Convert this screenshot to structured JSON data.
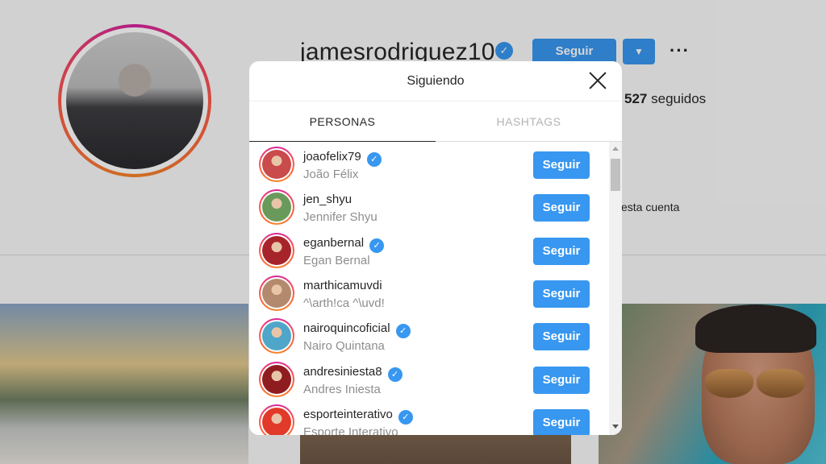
{
  "profile": {
    "username": "jamesrodriguez10",
    "follow_label": "Seguir",
    "more_label": "···",
    "following_count": "527",
    "following_label": "seguidos",
    "account_text": "esta cuenta"
  },
  "modal": {
    "title": "Siguiendo",
    "tabs": [
      {
        "label": "PERSONAS",
        "active": true
      },
      {
        "label": "HASHTAGS",
        "active": false
      }
    ],
    "follow_label": "Seguir",
    "accounts": [
      {
        "username": "joaofelix79",
        "full_name": "João Félix",
        "verified": true,
        "avatar_color": "#c94b4b"
      },
      {
        "username": "jen_shyu",
        "full_name": "Jennifer Shyu",
        "verified": false,
        "avatar_color": "#6a9a5b"
      },
      {
        "username": "eganbernal",
        "full_name": "Egan Bernal",
        "verified": true,
        "avatar_color": "#a8242b"
      },
      {
        "username": "marthicamuvdi",
        "full_name": "^\\arth!ca ^\\uvd!",
        "verified": false,
        "avatar_color": "#b38a6d"
      },
      {
        "username": "nairoquincoficial",
        "full_name": "Nairo Quintana",
        "verified": true,
        "avatar_color": "#4fa6c8"
      },
      {
        "username": "andresiniesta8",
        "full_name": "Andres Iniesta",
        "verified": true,
        "avatar_color": "#8f1d20"
      },
      {
        "username": "esporteinterativo",
        "full_name": "Esporte Interativo",
        "verified": true,
        "avatar_color": "#e23a2a"
      }
    ]
  }
}
